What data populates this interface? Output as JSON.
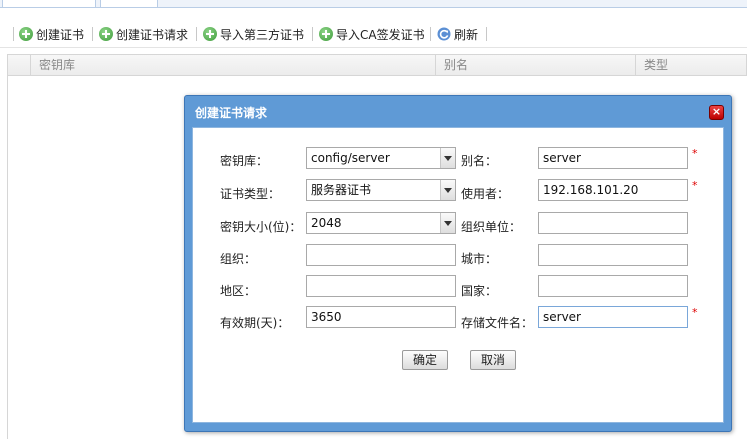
{
  "toolbar": {
    "create_cert": "创建证书",
    "create_cert_request": "创建证书请求",
    "import_third_party": "导入第三方证书",
    "import_ca_signed": "导入CA签发证书",
    "refresh": "刷新"
  },
  "grid": {
    "columns": [
      "密钥库",
      "别名",
      "类型"
    ]
  },
  "dialog": {
    "title": "创建证书请求",
    "close_symbol": "×",
    "fields": {
      "keystore": {
        "label": "密钥库：",
        "value": "config/server"
      },
      "alias": {
        "label": "别名：",
        "value": "server"
      },
      "cert_type": {
        "label": "证书类型：",
        "value": "服务器证书"
      },
      "user": {
        "label": "使用者：",
        "value": "192.168.101.20"
      },
      "key_size": {
        "label": "密钥大小(位)：",
        "value": "2048"
      },
      "org_unit": {
        "label": "组织单位：",
        "value": ""
      },
      "org": {
        "label": "组织：",
        "value": ""
      },
      "city": {
        "label": "城市：",
        "value": ""
      },
      "region": {
        "label": "地区：",
        "value": ""
      },
      "country": {
        "label": "国家：",
        "value": ""
      },
      "validity": {
        "label": "有效期(天)：",
        "value": "3650"
      },
      "store_filename": {
        "label": "存储文件名：",
        "value": "server"
      }
    },
    "required_mark": "*",
    "ok_label": "确定",
    "cancel_label": "取消"
  },
  "colors": {
    "dialog_frame": "#5f9ad6",
    "close_button": "#cc1111",
    "required": "#dd0000"
  },
  "icons": [
    "plus-circle-icon",
    "refresh-icon",
    "close-icon",
    "chevron-down-icon"
  ]
}
